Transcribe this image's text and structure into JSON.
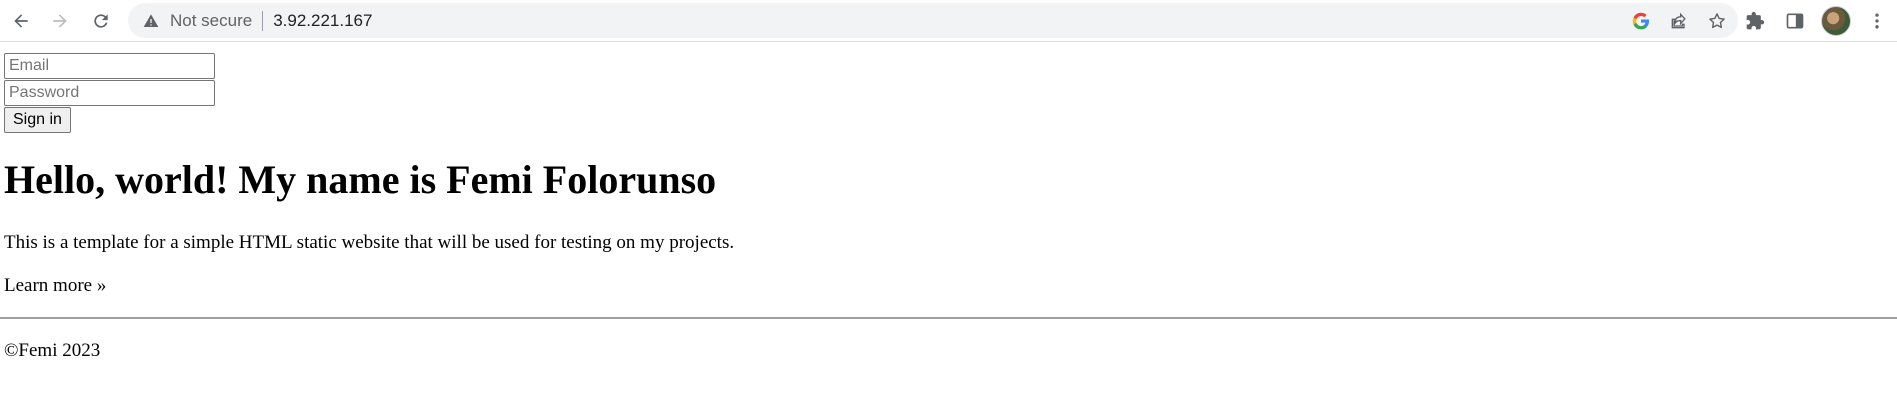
{
  "browser": {
    "security_label": "Not secure",
    "url": "3.92.221.167"
  },
  "icons": {
    "back": "back-arrow-icon",
    "forward": "forward-arrow-icon",
    "reload": "reload-icon",
    "warning": "warning-triangle-icon",
    "google": "google-g-icon",
    "share": "share-icon",
    "bookmark": "star-icon",
    "extensions": "puzzle-icon",
    "side_panel": "side-panel-icon",
    "profile": "avatar",
    "menu": "kebab-menu-icon"
  },
  "login": {
    "email_placeholder": "Email",
    "password_placeholder": "Password",
    "signin_label": "Sign in"
  },
  "content": {
    "heading": "Hello, world! My name is Femi Folorunso",
    "lead": "This is a template for a simple HTML static website that will be used for testing on my projects.",
    "learn_more": "Learn more »",
    "footer": "©Femi 2023"
  },
  "colors": {
    "omnibox_bg": "#f1f3f4",
    "divider": "#a0a0a0"
  }
}
